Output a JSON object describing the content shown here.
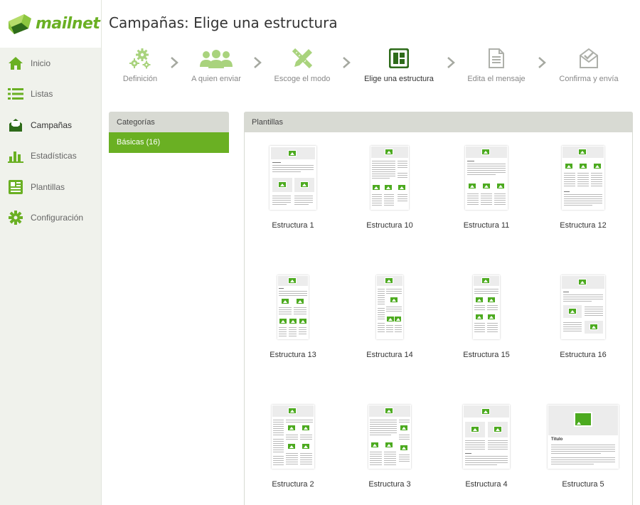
{
  "app": {
    "brand": "mailnet",
    "accent_color": "#6ab023",
    "icon_color": "#4caa1f"
  },
  "sidebar": {
    "items": [
      {
        "label": "Inicio",
        "icon": "home-icon"
      },
      {
        "label": "Listas",
        "icon": "list-icon"
      },
      {
        "label": "Campañas",
        "icon": "envelope-icon",
        "active": true
      },
      {
        "label": "Estadísticas",
        "icon": "bar-chart-icon"
      },
      {
        "label": "Plantillas",
        "icon": "newspaper-icon"
      },
      {
        "label": "Configuración",
        "icon": "gear-icon"
      }
    ]
  },
  "header": {
    "title": "Campañas: Elige una estructura"
  },
  "steps": [
    {
      "label": "Definición",
      "icon": "gears-icon"
    },
    {
      "label": "A quien enviar",
      "icon": "users-icon"
    },
    {
      "label": "Escoge el modo",
      "icon": "pencil-ruler-icon"
    },
    {
      "label": "Elige una estructura",
      "icon": "layout-icon",
      "current": true
    },
    {
      "label": "Edita el mensaje",
      "icon": "document-icon"
    },
    {
      "label": "Confirma y envía",
      "icon": "envelope-check-icon"
    }
  ],
  "categories": {
    "title": "Categorías",
    "items": [
      {
        "label": "Básicas (16)",
        "selected": true
      }
    ]
  },
  "templates": {
    "title": "Plantillas",
    "items": [
      {
        "label": "Estructura 1"
      },
      {
        "label": "Estructura 10"
      },
      {
        "label": "Estructura 11"
      },
      {
        "label": "Estructura 12"
      },
      {
        "label": "Estructura 13"
      },
      {
        "label": "Estructura 14"
      },
      {
        "label": "Estructura 15"
      },
      {
        "label": "Estructura 16"
      },
      {
        "label": "Estructura 2"
      },
      {
        "label": "Estructura 3"
      },
      {
        "label": "Estructura 4"
      },
      {
        "label": "Estructura 5",
        "thumb_heading": "Título"
      }
    ]
  }
}
